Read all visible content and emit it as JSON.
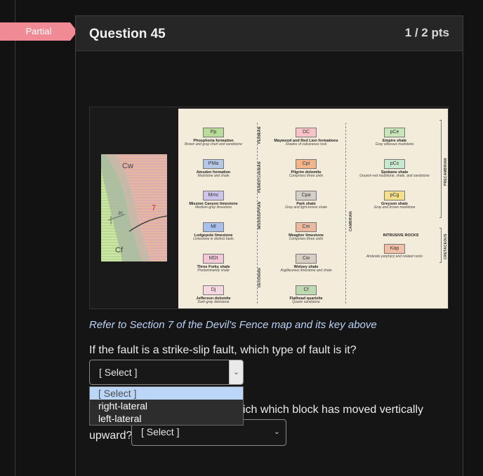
{
  "status_badge": {
    "label": "Partial",
    "color": "#f08b95"
  },
  "question": {
    "title": "Question 45",
    "points": "1 / 2 pts",
    "instruction": "Refer to Section 7 of the Devil's Fence map and its key above",
    "q1_text": "If the fault is a strike-slip fault, which type of fault is it?",
    "q2_text_line1": "ich which block has moved vertically",
    "q2_text_line2": "upward?"
  },
  "select1": {
    "value": "[ Select ]",
    "options": [
      "[ Select ]",
      "right-lateral",
      "left-lateral"
    ],
    "highlighted_index": 0
  },
  "select2": {
    "value": "[ Select ]"
  },
  "map": {
    "inset_labels": {
      "cw": "Cw",
      "cf": "Cf",
      "section": "7",
      "dip": "30"
    },
    "periods": [
      "PERMIAN",
      "PENNSYLVANIAN",
      "MISSISSIPPIAN",
      "DEVONIAN",
      "CAMBRIAN",
      "PRECAMBRIAN",
      "CRETACEOUS"
    ],
    "units": [
      {
        "code": "Pp",
        "name": "Phosphoria formation",
        "desc": "Brown and gray chert and sandstone",
        "color": "#b9dc9a"
      },
      {
        "code": "PMa",
        "name": "Amsden formation",
        "desc": "Mudstone and shale",
        "color": "#b4c8e6"
      },
      {
        "code": "Mmc",
        "name": "Mission Canyon limestone",
        "desc": "Medium-gray limestone",
        "color": "#cfc4ea"
      },
      {
        "code": "Ml",
        "name": "Lodgepole limestone",
        "desc": "Limestone in distinct beds",
        "color": "#a8c0ea"
      },
      {
        "code": "MDt",
        "name": "Three Forks shale",
        "desc": "Predominantly shale",
        "color": "#f3c8d8"
      },
      {
        "code": "Dj",
        "name": "Jefferson dolomite",
        "desc": "Dark-gray dolostone",
        "color": "#f6d8e2"
      },
      {
        "code": "DC",
        "name": "Maywood and Red Lion formations",
        "desc": "Shades of calcareous rock",
        "color": "#f7c3c9"
      },
      {
        "code": "Cpi",
        "name": "Pilgrim dolomite",
        "desc": "Comprises three units",
        "color": "#f3b48a"
      },
      {
        "code": "Cpa",
        "name": "Park shale",
        "desc": "Gray and light-brown shale",
        "color": "#d4cfc6"
      },
      {
        "code": "Cm",
        "name": "Meagher limestone",
        "desc": "Comprises three units",
        "color": "#eab9a0"
      },
      {
        "code": "Cw",
        "name": "Wolsey shale",
        "desc": "Argillaceous limestone and shale",
        "color": "#d7cfc4"
      },
      {
        "code": "Cf",
        "name": "Flathead quartzite",
        "desc": "Quartz sandstone",
        "color": "#bdd9b0"
      },
      {
        "code": "pCe",
        "name": "Empire shale",
        "desc": "Gray siliceous mudstone",
        "color": "#c8e6b8"
      },
      {
        "code": "pCs",
        "name": "Spokane shale",
        "desc": "Grayish-red mudstone, shale, and sandstone",
        "color": "#c8e8d0"
      },
      {
        "code": "pCg",
        "name": "Greyson shale",
        "desc": "Gray and brown mudstone",
        "color": "#f4e08a"
      },
      {
        "code": "Kap",
        "name": "",
        "desc": "Andesite porphyry and related rocks",
        "color": "#f0c0a8"
      }
    ],
    "intrusive_heading": "INTRUSIVE ROCKS"
  }
}
